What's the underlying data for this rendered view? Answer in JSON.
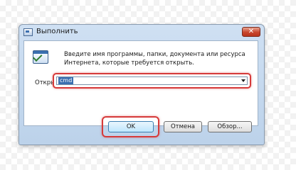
{
  "dialog": {
    "title": "Выполнить",
    "close_label": "✕",
    "description": "Введите имя программы, папки, документа или ресурса Интернета, которые требуется открыть.",
    "open_label": "Открыть:",
    "input_value": "cmd"
  },
  "buttons": {
    "ok_label": "OK",
    "cancel_label": "Отмена",
    "browse_label": "Обзор..."
  },
  "colors": {
    "highlight": "#d63a3a",
    "selection": "#3b6fb0"
  }
}
